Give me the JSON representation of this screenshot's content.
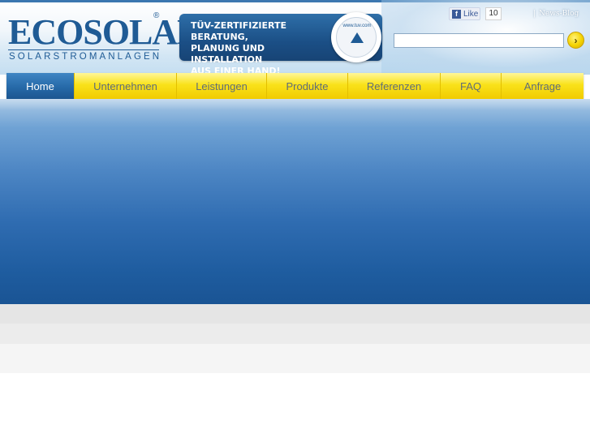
{
  "logo": {
    "brand": "ECOSOLAR",
    "registered": "®",
    "tagline": "SOLARSTROMANLAGEN"
  },
  "banner": {
    "text": "TÜV-ZERTIFIZIERTE BERATUNG,\nPLANUNG UND INSTALLATION\nAUS EINER HAND!",
    "seal_text": "www.tuv.com"
  },
  "social": {
    "like_label": "Like",
    "like_icon": "f",
    "like_count": "10"
  },
  "top_links": {
    "separator": "|",
    "news_blog": "News-Blog"
  },
  "search": {
    "value": "",
    "placeholder": "",
    "button_glyph": "›"
  },
  "nav": {
    "items": [
      {
        "label": "Home",
        "active": true
      },
      {
        "label": "Unternehmen"
      },
      {
        "label": "Leistungen"
      },
      {
        "label": "Produkte"
      },
      {
        "label": "Referenzen"
      },
      {
        "label": "FAQ"
      },
      {
        "label": "Anfrage"
      }
    ]
  },
  "colors": {
    "brand_blue": "#1f5b95",
    "nav_yellow": "#f9e21a",
    "nav_active": "#2669a8",
    "hero_blue": "#1e5c9f"
  }
}
